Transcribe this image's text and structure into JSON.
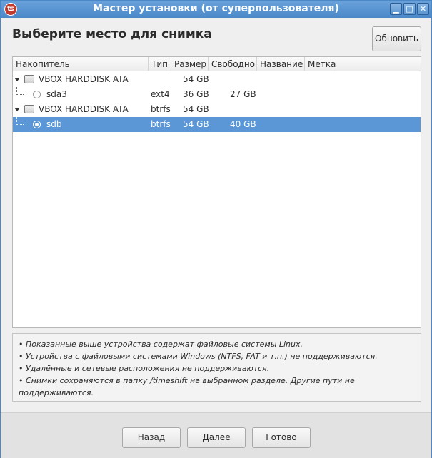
{
  "window": {
    "title": "Мастер установки (от суперпользователя)",
    "app_icon_glyph": "ʦ"
  },
  "heading": "Выберите место для снимка",
  "refresh_label": "Обновить",
  "table": {
    "columns": [
      "Накопитель",
      "Тип",
      "Размер",
      "Свободно",
      "Название",
      "Метка"
    ],
    "rows": [
      {
        "kind": "disk",
        "name": "VBOX HARDDISK ATA",
        "type": "",
        "size": "54 GB",
        "free": "",
        "label": "",
        "tag": ""
      },
      {
        "kind": "partition",
        "name": "sda3",
        "type": "ext4",
        "size": "36 GB",
        "free": "27 GB",
        "label": "",
        "tag": "",
        "selected": false
      },
      {
        "kind": "disk",
        "name": "VBOX HARDDISK ATA",
        "type": "btrfs",
        "size": "54 GB",
        "free": "",
        "label": "",
        "tag": ""
      },
      {
        "kind": "partition",
        "name": "sdb",
        "type": "btrfs",
        "size": "54 GB",
        "free": "40 GB",
        "label": "",
        "tag": "",
        "selected": true
      }
    ]
  },
  "notes": [
    "• Показанные выше устройства содержат файловые системы Linux.",
    "• Устройства с файловыми системами Windows (NTFS, FAT и т.п.) не поддерживаются.",
    "• Удалённые и сетевые расположения не поддерживаются.",
    "• Снимки сохраняются в папку /timeshift на выбранном разделе. Другие пути не поддерживаются."
  ],
  "footer": {
    "back": "Назад",
    "next": "Далее",
    "finish": "Готово"
  },
  "colors": {
    "titlebar": "#4a88c8",
    "selection": "#5b97d6"
  }
}
